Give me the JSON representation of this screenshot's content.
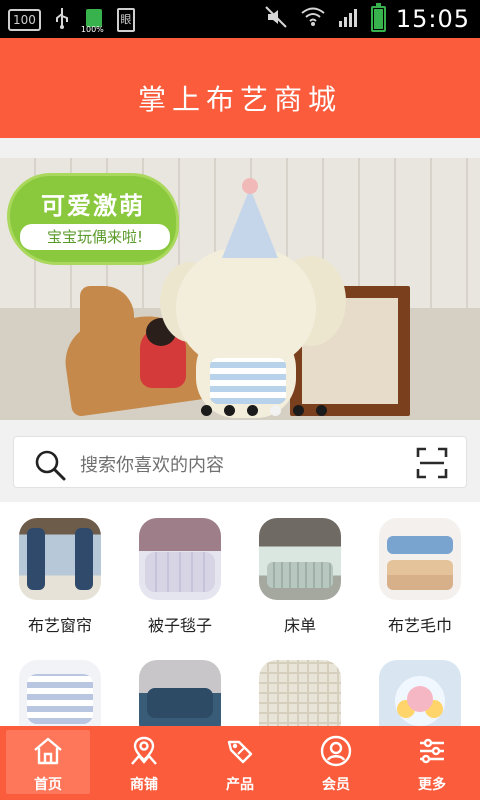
{
  "status_bar": {
    "time": "15:05",
    "battery_small_label": "100%",
    "box_label": "100",
    "note_label": "眼"
  },
  "header": {
    "title": "掌上布艺商城"
  },
  "banner": {
    "badge_line1": "可爱激萌",
    "badge_line2": "宝宝玩偶来啦!",
    "active_dot_index": 3,
    "dot_count": 6
  },
  "search": {
    "placeholder": "搜索你喜欢的内容"
  },
  "categories": [
    {
      "label": "布艺窗帘",
      "icon": "curtain-image"
    },
    {
      "label": "被子毯子",
      "icon": "quilt-image"
    },
    {
      "label": "床单",
      "icon": "bedsheet-image"
    },
    {
      "label": "布艺毛巾",
      "icon": "towel-image"
    },
    {
      "label": "",
      "icon": "pillow-image"
    },
    {
      "label": "",
      "icon": "sofa-image"
    },
    {
      "label": "",
      "icon": "rug-image"
    },
    {
      "label": "",
      "icon": "flower-image"
    }
  ],
  "tabbar": {
    "items": [
      {
        "label": "首页",
        "icon": "home-icon",
        "active": true
      },
      {
        "label": "商铺",
        "icon": "store-icon",
        "active": false
      },
      {
        "label": "产品",
        "icon": "product-tag-icon",
        "active": false
      },
      {
        "label": "会员",
        "icon": "member-icon",
        "active": false
      },
      {
        "label": "更多",
        "icon": "settings-sliders-icon",
        "active": false
      }
    ]
  },
  "colors": {
    "accent": "#fa5c3c",
    "status_bar_bg": "#000000",
    "page_bg": "#f1f1f1"
  }
}
